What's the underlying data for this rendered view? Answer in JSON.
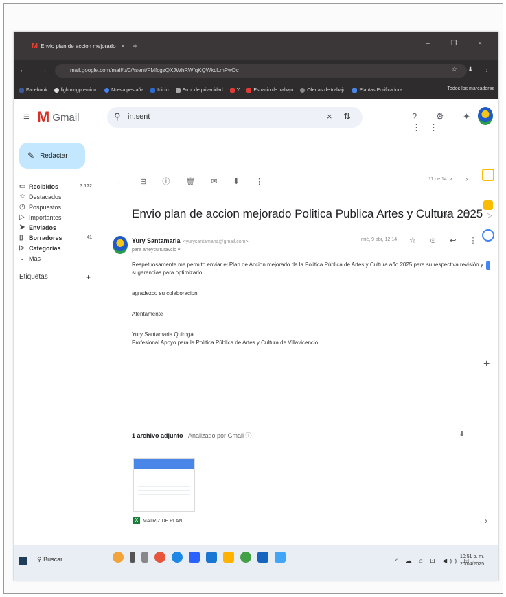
{
  "browser": {
    "tab_title": "Envio plan de accion mejorado",
    "tab_close": "×",
    "new_tab": "+",
    "window_controls": "– ❐ ×",
    "nav": "← → C",
    "url": "mail.google.com/mail/u/0/#sent/FMfcgzQXJWhRWfqKQWkdLmPwDc",
    "url_icons": "☆ ⬇ ⋮",
    "bookmarks": [
      "Facebook",
      "lightningpremium",
      "Nueva pestaña",
      "Inicio",
      "Error de privacidad",
      "Y",
      "Espacio de trabajo",
      "Ofertas de trabajo",
      "Plantas Purificadora..."
    ],
    "bookmarks_right": "Todos los marcadores"
  },
  "gmail": {
    "menu_icon": "≡",
    "logo_letter": "M",
    "logo_text": "Gmail",
    "search_icon": "⚲",
    "search_value": "in:sent",
    "search_clear": "×",
    "search_options": "⇅",
    "top_icons": "? ⚙ ✦ ⋮⋮"
  },
  "sidebar": {
    "compose": "Redactar",
    "items": [
      {
        "icon": "▭",
        "label": "Recibidos",
        "count": "3.172",
        "bold": true
      },
      {
        "icon": "☆",
        "label": "Destacados",
        "count": "",
        "bold": false
      },
      {
        "icon": "◷",
        "label": "Pospuestos",
        "count": "",
        "bold": false
      },
      {
        "icon": "▷",
        "label": "Importantes",
        "count": "",
        "bold": false
      },
      {
        "icon": "➤",
        "label": "Enviados",
        "count": "",
        "bold": true
      },
      {
        "icon": "▯",
        "label": "Borradores",
        "count": "41",
        "bold": true
      },
      {
        "icon": "▷",
        "label": "Categorías",
        "count": "",
        "bold": true
      },
      {
        "icon": "⌄",
        "label": "Más",
        "count": "",
        "bold": false
      }
    ],
    "labels_title": "Etiquetas",
    "labels_plus": "+"
  },
  "toolbar": {
    "icons": "← ⊟ ⓘ 🗑 ✉ ⬇ ⋮",
    "page_info": "11 de 14",
    "page_nav": "‹ ›"
  },
  "email": {
    "subject": "Envio plan de accion mejorado Politica Publica Artes y Cultura 2025",
    "subject_tag": "▷",
    "subject_icons": "⎙ ⧉",
    "sender_name": "Yury Santamaria",
    "sender_email": "<yurysantamaria@gmail.com>",
    "to": "para arteyculturavcio ▾",
    "date": "mié, 9 abr, 12:14",
    "msg_icons": "☆ ☺ ↩ ⋮",
    "body": [
      "Respetuosamente me permito enviar el Plan de Accion mejorado de la Política Pública de Artes y Cultura año 2025 para su respectiva revisión y sugerencias para optimizarlo",
      "agradezco su colaboracion",
      "Atentamente"
    ],
    "signature": [
      "Yury Santamaria Quiroga",
      "Profesional Apoyo para la Política Pública de Artes y Cultura de Villavicencio"
    ],
    "attachment_title": "1 archivo adjunto",
    "attachment_sub": " · Analizado por Gmail ⓘ",
    "attachment_download": "⬇",
    "attachment_name": "MATRIZ DE PLAN..."
  },
  "right_rail": {
    "plus": "+",
    "chevron": "›"
  },
  "taskbar": {
    "search": "Buscar",
    "tray": "^ ☁ ⌂ ⊡ ◀)) ⊟",
    "time": "10:51 p. m.",
    "date": "20/04/2025"
  }
}
